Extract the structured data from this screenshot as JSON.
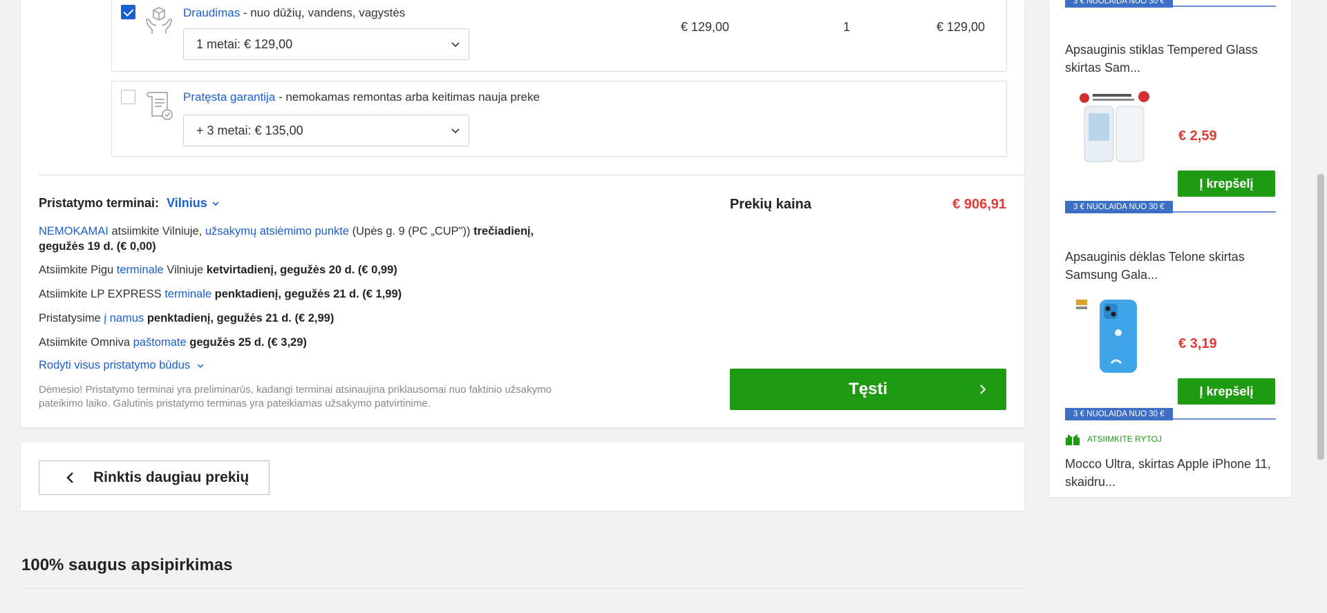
{
  "addons": [
    {
      "checked": true,
      "icon": "insurance-hands-box-icon",
      "link": "Draudimas",
      "desc": " - nuo dūžių, vandens, vagystės",
      "select_value": "1 metai: € 129,00",
      "price": "€ 129,00",
      "qty": "1",
      "total": "€ 129,00"
    },
    {
      "checked": false,
      "icon": "warranty-document-icon",
      "link": "Pratęsta garantija",
      "desc": " - nemokamas remontas arba keitimas nauja preke",
      "select_value": "+ 3 metai: € 135,00"
    }
  ],
  "delivery": {
    "label": "Pristatymo terminai:",
    "city": "Vilnius",
    "lines": [
      {
        "p1": "NEMOKAMAI",
        "p2": " atsiimkite Vilniuje, ",
        "p3": "užsakymų atsiėmimo punkte",
        "p4": " (Upės g. 9 (PC „CUP\")) ",
        "p5": "trečiadienį, gegužės 19 d. (€ 0,00)"
      },
      {
        "p1": "Atsiimkite Pigu ",
        "p2": "terminale",
        "p3": " Vilniuje ",
        "p4": "ketvirtadienį, gegužės 20 d. (€ 0,99)"
      },
      {
        "p1": "Atsiimkite LP EXPRESS ",
        "p2": "terminale",
        "p3": " ",
        "p4": "penktadienį, gegužės 21 d. (€ 1,99)"
      },
      {
        "p1": "Pristatysime ",
        "p2": "į namus",
        "p3": " ",
        "p4": "penktadienį, gegužės 21 d. (€ 2,99)"
      },
      {
        "p1": "Atsiimkite Omniva ",
        "p2": "paštomate",
        "p3": " ",
        "p4": "gegužės 25 d. (€ 3,29)"
      }
    ],
    "show_all": "Rodyti visus pristatymo būdus",
    "notice": "Dėmesio! Pristatymo terminai yra preliminarūs, kadangi terminai atsinaujina priklausomai nuo faktinio užsakymo pateikimo laiko. Galutinis pristatymo terminas yra pateikiamas užsakymo patvirtinime."
  },
  "summary": {
    "label": "Prekių kaina",
    "value": "€ 906,91",
    "continue": "Tęsti"
  },
  "back_button": "Rinktis daugiau prekių",
  "safe_title": "100% saugus apsipirkimas",
  "sidebar": {
    "promo": "3 € NUOLAIDA NUO 30 €",
    "products": [
      {
        "title": "Apsauginis stiklas Tempered Glass skirtas Sam...",
        "price": "€ 2,59",
        "button": "Į krepšelį"
      },
      {
        "title": "Apsauginis dėklas Telone skirtas Samsung Gala...",
        "price": "€ 3,19",
        "button": "Į krepšelį"
      },
      {
        "title": "Mocco Ultra, skirtas Apple iPhone 11, skaidru..."
      }
    ],
    "pickup": "ATSIIMKITE RYTOJ"
  },
  "colors": {
    "link": "#1a5fd0",
    "primary_button": "#1e9b12",
    "price": "#e53935",
    "promo": "#3d6fc7"
  }
}
